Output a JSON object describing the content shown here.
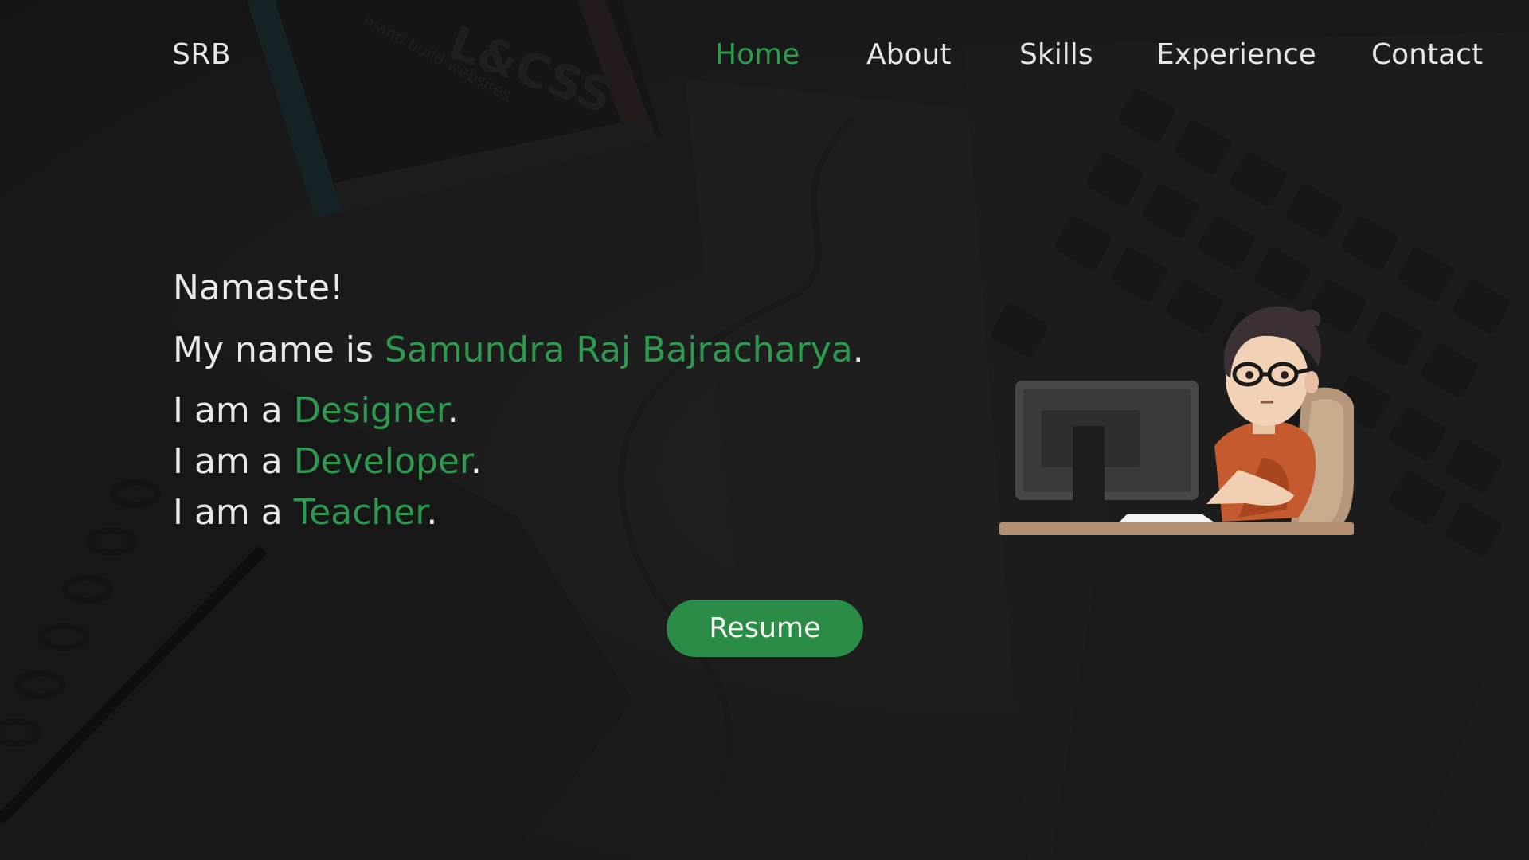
{
  "nav": {
    "logo": "SRB",
    "links": [
      {
        "label": "Home",
        "active": true
      },
      {
        "label": "About"
      },
      {
        "label": "Skills"
      },
      {
        "label": "Experience"
      },
      {
        "label": "Contact"
      }
    ]
  },
  "hero": {
    "greeting": "Namaste!",
    "name_prefix": "My name is ",
    "name": "Samundra Raj Bajracharya",
    "name_suffix": ".",
    "roles": [
      {
        "prefix": "I am a ",
        "role": "Designer",
        "suffix": "."
      },
      {
        "prefix": "I am a ",
        "role": "Developer",
        "suffix": "."
      },
      {
        "prefix": "I am a ",
        "role": "Teacher",
        "suffix": "."
      }
    ],
    "resume_label": "Resume"
  },
  "colors": {
    "accent": "#2e9a4f",
    "button": "#2b8c48",
    "text": "#e8e8e8",
    "background": "#1b1b1b"
  },
  "background_image": {
    "overlay_text_1": "L&CSS",
    "overlay_text_2": "n and build websites"
  },
  "illustration": {
    "icon": "developer-at-computer-icon"
  }
}
